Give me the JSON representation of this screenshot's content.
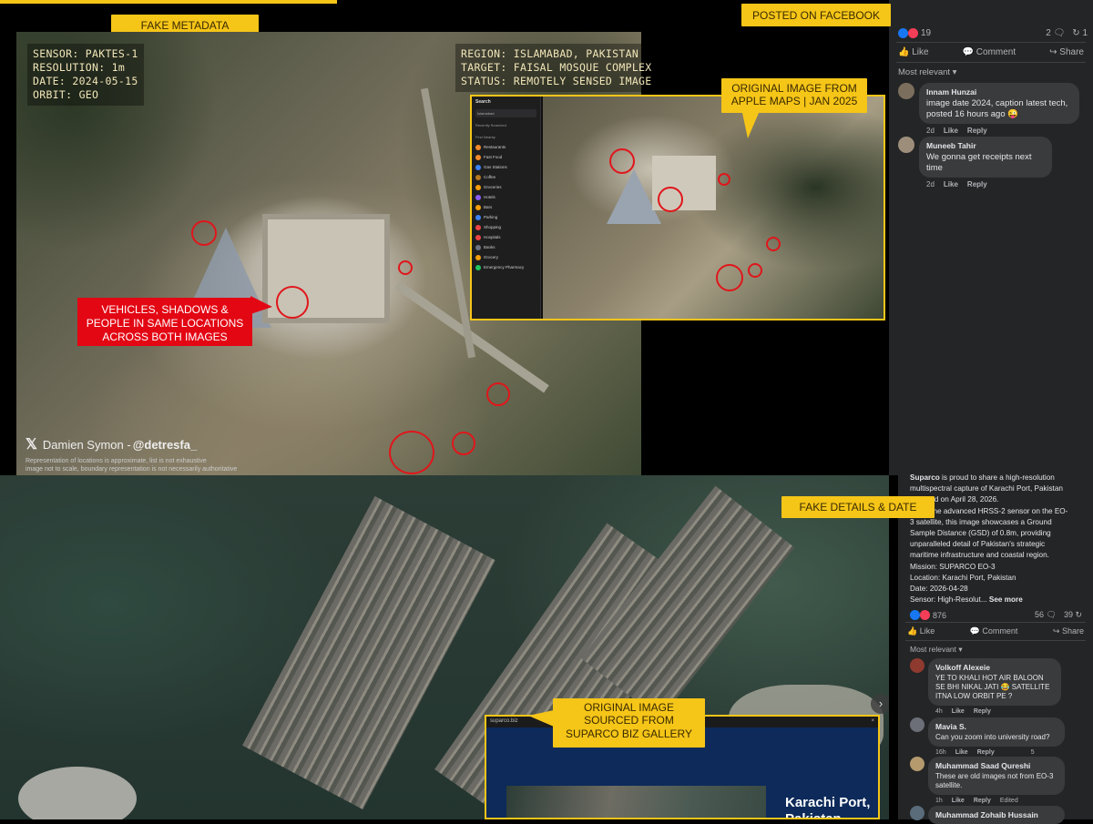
{
  "top_banner": {
    "label_fake_metadata": "FAKE METADATA",
    "label_posted": "POSTED ON FACEBOOK"
  },
  "sat_image_1": {
    "metadata_left": [
      "SENSOR: PAKTES-1",
      "RESOLUTION: 1m",
      "DATE: 2024-05-15",
      "ORBIT: GEO"
    ],
    "metadata_right": [
      "REGION: ISLAMABAD, PAKISTAN",
      "TARGET: FAISAL MOSQUE COMPLEX",
      "STATUS: REMOTELY SENSED IMAGE"
    ],
    "red_callout": [
      "VEHICLES, SHADOWS &",
      "PEOPLE IN SAME LOCATIONS",
      "ACROSS BOTH IMAGES"
    ],
    "credit_name": "Damien Symon - ",
    "credit_handle": "@detresfa_",
    "disclaimer": [
      "Representation of locations is approximate, list is not exhaustive",
      "image not to scale, boundary representation is not necessarily authoritative"
    ]
  },
  "apple_maps": {
    "callout": [
      "ORIGINAL IMAGE FROM",
      "APPLE MAPS | JAN 2025"
    ],
    "sidebar_title": "Search",
    "sidebar_search": "Islamabad",
    "sidebar_recent": "Recently Searched",
    "sidebar_find": "Find Nearby",
    "sidebar_items": [
      "Restaurants",
      "Fast Food",
      "Gas Stations",
      "Coffee",
      "Groceries",
      "Hotels",
      "Bars",
      "Parking",
      "Shopping",
      "Hospitals",
      "Banks",
      "Grocery",
      "Emergency Pharmacy"
    ],
    "sidebar_item_colors": [
      "#f28a2c",
      "#f28a2c",
      "#3b82f6",
      "#b7791f",
      "#f59e0b",
      "#8b5cf6",
      "#f59e0b",
      "#3b82f6",
      "#ef4444",
      "#ef4444",
      "#6b7280",
      "#f59e0b",
      "#22c55e"
    ]
  },
  "fb_post_1": {
    "reaction_count": "19",
    "comments_count": "2",
    "shares_count": "1",
    "like_label": "Like",
    "comment_label": "Comment",
    "share_label": "Share",
    "sort_label": "Most relevant",
    "comments": [
      {
        "author": "Innam Hunzai",
        "text": "image date 2024, caption latest tech, posted 16 hours ago 😜",
        "time": "2d",
        "like": "Like",
        "reply": "Reply"
      },
      {
        "author": "Muneeb Tahir",
        "text": "We gonna get receipts next time",
        "time": "2d",
        "like": "Like",
        "reply": "Reply"
      }
    ]
  },
  "fb_post_2": {
    "author": "Suparco",
    "body_lines": [
      " is proud to share a high-resolution",
      "multispectral capture of Karachi Port, Pakistan",
      "acquired on April 28, 2026.",
      "Using the advanced HRSS-2 sensor on the EO-",
      "3 satellite, this image showcases a Ground",
      "Sample Distance (GSD) of 0.8m, providing",
      "unparalleled detail of Pakistan's strategic",
      "maritime infrastructure and coastal region.",
      "Mission: SUPARCO EO-3",
      "Location: Karachi Port, Pakistan",
      "Date: 2026-04-28",
      "Sensor: High-Resolut... "
    ],
    "see_more": "See more",
    "reaction_count": "876",
    "comments_count": "56",
    "shares_count": "39",
    "like_label": "Like",
    "comment_label": "Comment",
    "share_label": "Share",
    "sort_label": "Most relevant",
    "comments": [
      {
        "author": "Volkoff Alexeie",
        "text": "YE TO KHALI HOT AIR BALOON SE BHI NIKAL JATI 😂 SATELLITE ITNA LOW ORBIT PE ?",
        "time": "4h",
        "like": "Like",
        "reply": "Reply",
        "extra": ""
      },
      {
        "author": "Mavia S.",
        "text": "Can you zoom into university road?",
        "time": "16h",
        "like": "Like",
        "reply": "Reply",
        "extra": "5"
      },
      {
        "author": "Muhammad Saad Qureshi",
        "text": "These are old images not from EO-3 satellite.",
        "time": "1h",
        "like": "Like",
        "reply": "Reply",
        "extra": "Edited"
      },
      {
        "author": "Muhammad Zohaib Hussain",
        "text": "",
        "time": "",
        "like": "",
        "reply": "",
        "extra": ""
      }
    ]
  },
  "callouts_bottom": {
    "fake_details": "FAKE DETAILS & DATE",
    "suparco_source": [
      "ORIGINAL IMAGE",
      "SOURCED FROM",
      "SUPARCO BIZ GALLERY"
    ]
  },
  "suparco_site": {
    "url": "suparco.biz",
    "title_lines": [
      "Karachi Port,",
      "Pakistan"
    ]
  },
  "colors": {
    "callout_yellow": "#f5c518",
    "red": "#e30613",
    "fb_bg": "#242526",
    "fb_blue": "#1877f2"
  }
}
